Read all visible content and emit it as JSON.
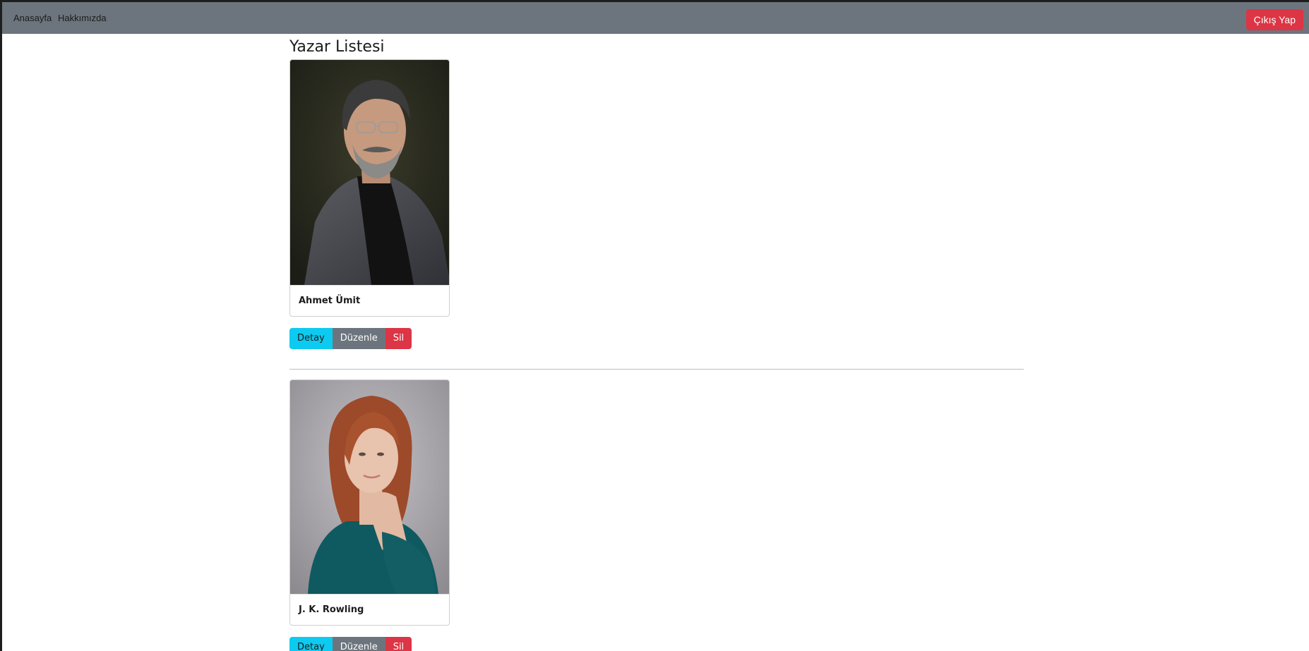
{
  "navbar": {
    "home_label": "Anasayfa",
    "about_label": "Hakkımızda",
    "logout_label": "Çıkış Yap"
  },
  "page": {
    "title": "Yazar Listesi"
  },
  "authors": [
    {
      "name": "Ahmet Ümit",
      "photo": "man-portrait-photo"
    },
    {
      "name": "J. K. Rowling",
      "photo": "woman-portrait-photo"
    }
  ],
  "actions": {
    "detail_label": "Detay",
    "edit_label": "Düzenle",
    "delete_label": "Sil"
  },
  "colors": {
    "navbar": "#6c757d",
    "danger": "#dc3545",
    "info": "#0dcaf0",
    "secondary": "#6c757d"
  }
}
